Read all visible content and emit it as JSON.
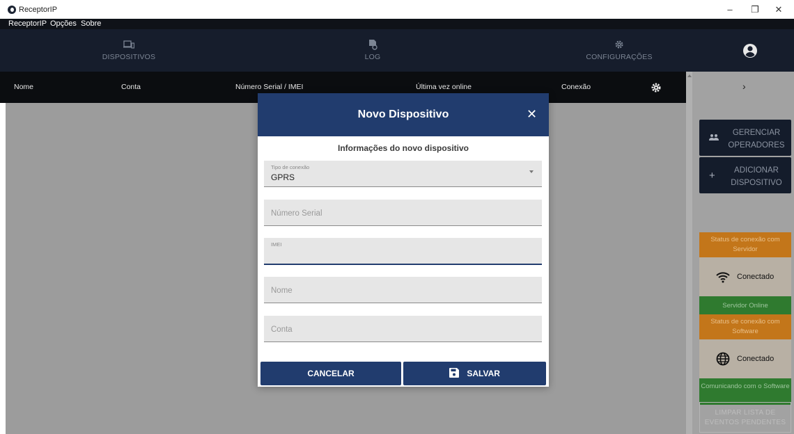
{
  "window": {
    "title": "ReceptorIP",
    "controls": {
      "minimize": "–",
      "restore": "❐",
      "close": "✕"
    }
  },
  "menu": {
    "items": [
      "ReceptorIP",
      "Opções",
      "Sobre"
    ]
  },
  "nav": {
    "items": [
      {
        "label": "DISPOSITIVOS",
        "icon": "devices-icon"
      },
      {
        "label": "LOG",
        "icon": "log-icon"
      },
      {
        "label": "CONFIGURAÇÕES",
        "icon": "gear-icon"
      }
    ],
    "user_icon": "account-circle-icon"
  },
  "table": {
    "columns": [
      "Nome",
      "Conta",
      "Número Serial / IMEI",
      "Última vez online",
      "Conexão"
    ]
  },
  "sidebar": {
    "chevron": "›",
    "manage_operators": "GERENCIAR OPERADORES",
    "add_device": "ADICIONAR DISPOSITIVO",
    "server_status": {
      "header": "Status de conexão com Servidor",
      "state": "Conectado",
      "footer": "Servidor Online"
    },
    "software_status": {
      "header": "Status de conexão com Software",
      "state": "Conectado",
      "footer": "Comunicando com o Software"
    },
    "clear_pending": "LIMPAR LISTA DE EVENTOS PENDENTES"
  },
  "modal": {
    "title": "Novo Dispositivo",
    "close": "✕",
    "subtitle": "Informações do novo dispositivo",
    "fields": {
      "connection_type": {
        "label": "Tipo de conexão",
        "value": "GPRS"
      },
      "serial_number": {
        "placeholder": "Número Serial"
      },
      "imei": {
        "label": "IMEI",
        "value": ""
      },
      "name": {
        "placeholder": "Nome"
      },
      "account": {
        "placeholder": "Conta"
      }
    },
    "cancel_label": "CANCELAR",
    "save_label": "SALVAR"
  },
  "colors": {
    "navy": "#213c6e",
    "dark_nav": "#161d2c",
    "status_orange": "#c3761a",
    "status_green": "#2f7a2f"
  }
}
